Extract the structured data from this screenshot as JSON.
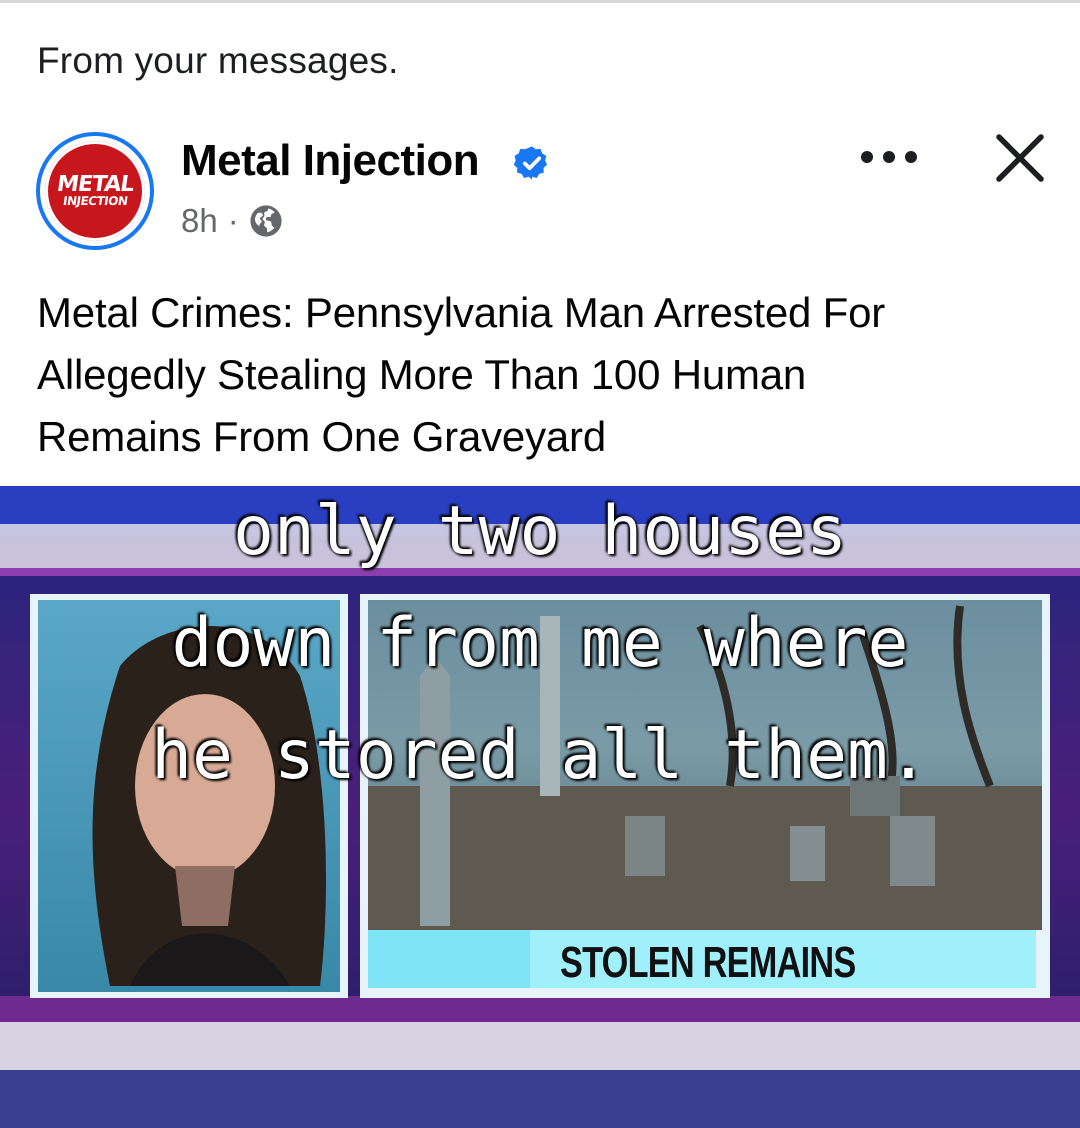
{
  "context_label": "From your messages.",
  "post": {
    "page_name": "Metal Injection",
    "avatar_text": [
      "METAL",
      "INJECTION"
    ],
    "time": "8h",
    "separator": "·",
    "audience_icon": "globe-icon",
    "text_lines": [
      "Metal Crimes: Pennsylvania Man Arrested For",
      "Allegedly Stealing More Than 100 Human",
      "Remains From One Graveyard"
    ]
  },
  "media": {
    "caption_lines": [
      "only two houses",
      "down from me where",
      "he stored all them."
    ],
    "lower_third": "STOLEN REMAINS"
  },
  "colors": {
    "verified": "#1877f2",
    "avatar_red": "#c8161d",
    "meta_gray": "#65676b"
  }
}
